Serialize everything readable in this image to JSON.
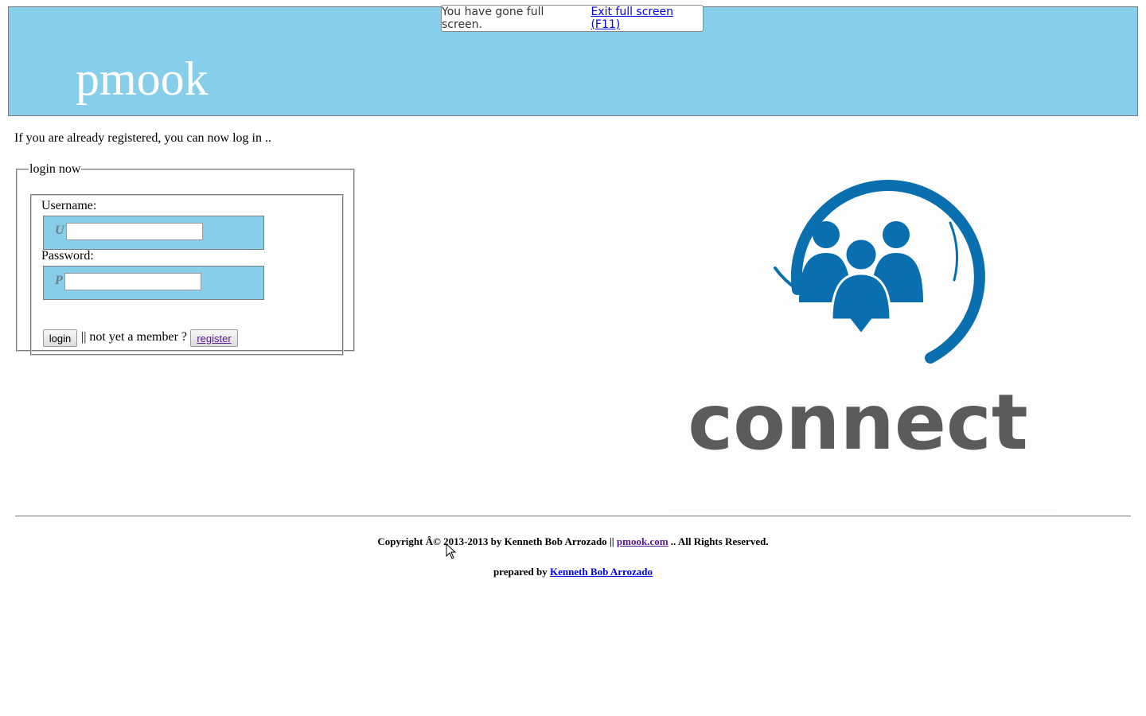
{
  "header": {
    "site_title": "pmook",
    "background_color": "#87ceeb"
  },
  "fullscreen_notice": {
    "message": "You have gone full screen.",
    "exit_link": "Exit full screen (F11)"
  },
  "intro_text": "If you are already registered, you can now log in ..",
  "login": {
    "legend": "login now",
    "username_label": "Username:",
    "username_icon": "U",
    "username_value": "",
    "password_label": "Password:",
    "password_icon": "P",
    "password_value": "",
    "login_button": "login",
    "separator": "||",
    "not_member_text": "not yet a member ?",
    "register_button": "register"
  },
  "logo": {
    "text": "connect",
    "icon": "people-group-icon",
    "blue": "#0a6fae",
    "gray": "#5b5b5b"
  },
  "footer": {
    "copyright_prefix": "Copyright Â© 2013-2013 by Kenneth Bob Arrozado ||",
    "site_link": "pmook.com",
    "copyright_suffix": ".. All Rights Reserved.",
    "prepared_prefix": "prepared by",
    "author_link": "Kenneth Bob Arrozado"
  }
}
